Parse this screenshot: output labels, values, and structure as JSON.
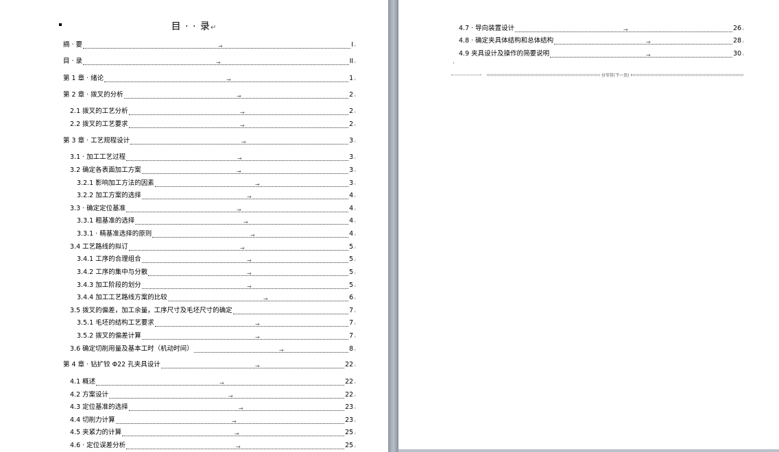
{
  "title": "目 · · 录",
  "left_entries": [
    {
      "label": "摘 · 要",
      "page": "I"
    },
    {
      "label": "目 · 录",
      "page": "II"
    },
    {
      "label": "第 1 章 · 绪论",
      "page": "1"
    },
    {
      "label": "第 2 章 · 拨叉的分析",
      "page": "2"
    },
    {
      "label": "2.1 拨叉的工艺分析",
      "page": "2"
    },
    {
      "label": "2.2 拨叉的工艺要求",
      "page": "2"
    },
    {
      "label": "第 3 章 · 工艺规程设计",
      "page": "3"
    },
    {
      "label": "3.1 · 加工工艺过程",
      "page": "3"
    },
    {
      "label": "3.2 确定各表面加工方案",
      "page": "3"
    },
    {
      "label": "3.2.1 影响加工方法的因素",
      "page": "3"
    },
    {
      "label": "3.2.2 加工方案的选择",
      "page": "4"
    },
    {
      "label": "3.3 · 确定定位基准",
      "page": "4"
    },
    {
      "label": "3.3.1 粗基准的选择",
      "page": "4"
    },
    {
      "label": "3.3.1 · 精基准选择的原则",
      "page": "4"
    },
    {
      "label": "3.4 工艺路线的拟订",
      "page": "5"
    },
    {
      "label": "3.4.1 工序的合理组合",
      "page": "5"
    },
    {
      "label": "3.4.2 工序的集中与分散",
      "page": "5"
    },
    {
      "label": "3.4.3 加工阶段的划分",
      "page": "5"
    },
    {
      "label": "3.4.4 加工工艺路线方案的比较",
      "page": "6"
    },
    {
      "label": "3.5 拨叉的偏差，加工余量，工序尺寸及毛坯尺寸的确定",
      "page": "7"
    },
    {
      "label": "3.5.1 毛坯的结构工艺要求",
      "page": "7"
    },
    {
      "label": "3.5.2 拨叉的偏差计算",
      "page": "7"
    },
    {
      "label": "3.6 确定切削用量及基本工时（机动时间）",
      "page": "8"
    },
    {
      "label": "第 4 章 · 钻扩铰 Φ22 孔夹具设计",
      "page": "22"
    },
    {
      "label": "4.1 概述",
      "page": "22"
    },
    {
      "label": "4.2 方案设计",
      "page": "22"
    },
    {
      "label": "4.3 定位基准的选择",
      "page": "23"
    },
    {
      "label": "4.4 切削力计算",
      "page": "23"
    },
    {
      "label": "4.5 夹紧力的计算",
      "page": "25"
    },
    {
      "label": "4.6 · 定位误差分析",
      "page": "25"
    }
  ],
  "right_entries": [
    {
      "label": "4.7 · 导向装置设计",
      "page": "26"
    },
    {
      "label": "4.8 · 确定夹具体结构和总体结构",
      "page": "28"
    },
    {
      "label": "4.9 夹具设计及操作的简要说明",
      "page": "30"
    }
  ],
  "section_break": "分节符(下一页)",
  "tab_mark": "→",
  "end_mark": "↵",
  "small_mark": "‹"
}
